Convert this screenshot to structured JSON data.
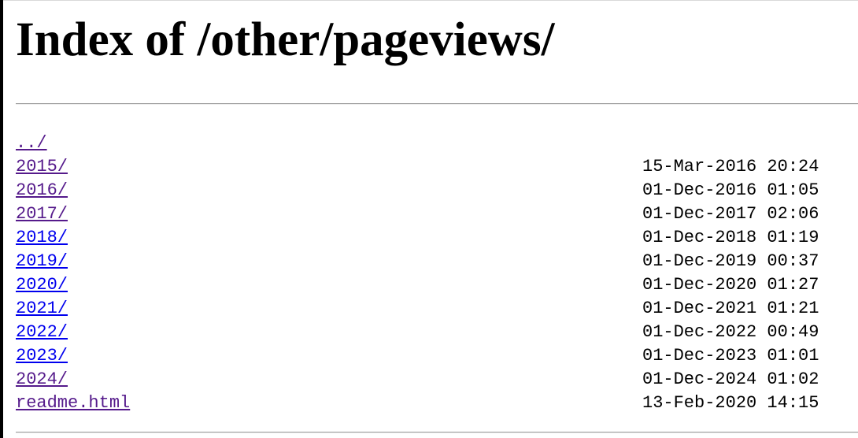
{
  "page": {
    "title": "Index of /other/pageviews/"
  },
  "link_colors": {
    "visited": "#551a8b",
    "unvisited": "#0000ee"
  },
  "listing": {
    "parent": {
      "name": "../",
      "visited": true
    },
    "entries": [
      {
        "name": "2015/",
        "modified": "15-Mar-2016 20:24",
        "visited": true
      },
      {
        "name": "2016/",
        "modified": "01-Dec-2016 01:05",
        "visited": true
      },
      {
        "name": "2017/",
        "modified": "01-Dec-2017 02:06",
        "visited": true
      },
      {
        "name": "2018/",
        "modified": "01-Dec-2018 01:19",
        "visited": false
      },
      {
        "name": "2019/",
        "modified": "01-Dec-2019 00:37",
        "visited": false
      },
      {
        "name": "2020/",
        "modified": "01-Dec-2020 01:27",
        "visited": false
      },
      {
        "name": "2021/",
        "modified": "01-Dec-2021 01:21",
        "visited": false
      },
      {
        "name": "2022/",
        "modified": "01-Dec-2022 00:49",
        "visited": false
      },
      {
        "name": "2023/",
        "modified": "01-Dec-2023 01:01",
        "visited": false
      },
      {
        "name": "2024/",
        "modified": "01-Dec-2024 01:02",
        "visited": true
      },
      {
        "name": "readme.html",
        "modified": "13-Feb-2020 14:15",
        "visited": true
      }
    ]
  }
}
